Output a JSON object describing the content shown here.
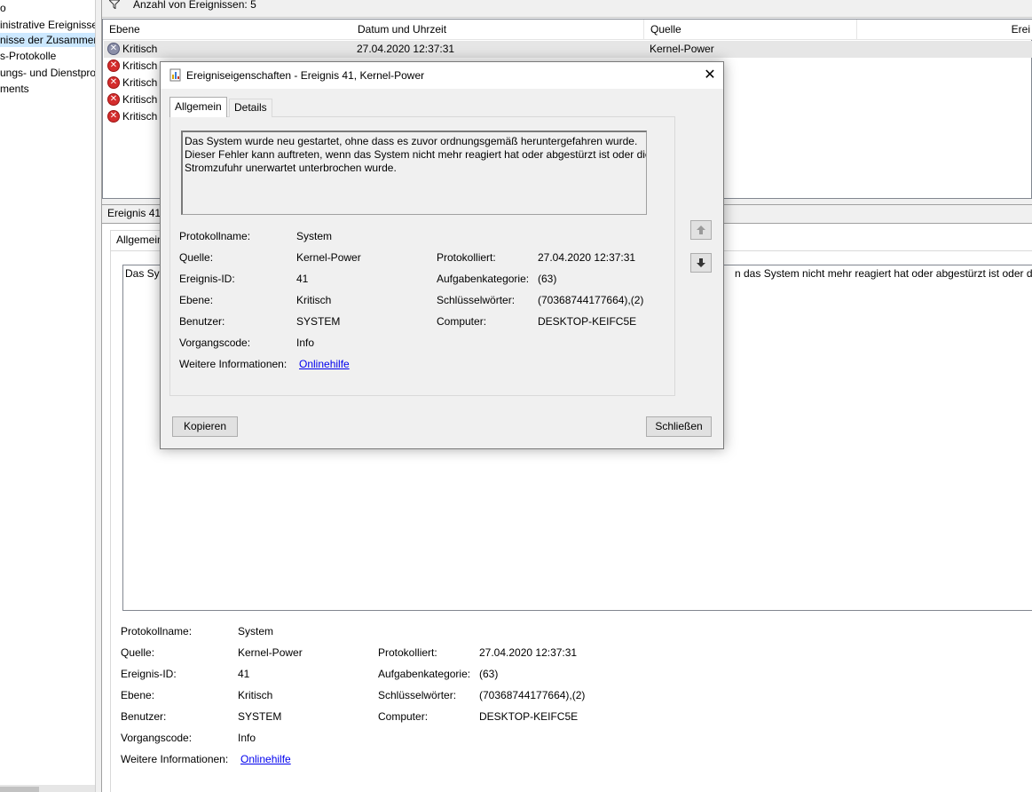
{
  "tree": {
    "items": [
      {
        "label": "o",
        "selected": false
      },
      {
        "label": "inistrative Ereignisse",
        "selected": false
      },
      {
        "label": "nisse der Zusammen",
        "selected": true
      },
      {
        "label": "s-Protokolle",
        "selected": false
      },
      {
        "label": "ungs- und Dienstpro",
        "selected": false
      },
      {
        "label": "ments",
        "selected": false
      }
    ]
  },
  "list": {
    "event_count": "Anzahl von Ereignissen: 5",
    "columns": [
      "Ebene",
      "Datum und Uhrzeit",
      "Quelle",
      "Erei"
    ],
    "rows": [
      {
        "level": "Kritisch",
        "datetime": "27.04.2020 12:37:31",
        "source": "Kernel-Power"
      },
      {
        "level": "Kritisch",
        "datetime": "",
        "source": ""
      },
      {
        "level": "Kritisch",
        "datetime": "",
        "source": ""
      },
      {
        "level": "Kritisch",
        "datetime": "",
        "source": ""
      },
      {
        "level": "Kritisch",
        "datetime": "",
        "source": ""
      }
    ]
  },
  "bottom": {
    "title": "Ereignis 41,",
    "tab": "Allgemein",
    "desc_left": "Das Sys",
    "desc_right": "n das System nicht mehr reagiert hat oder abgestürzt ist oder die S"
  },
  "props": {
    "log_name_label": "Protokollname:",
    "log_name": "System",
    "source_label": "Quelle:",
    "source": "Kernel-Power",
    "event_id_label": "Ereignis-ID:",
    "event_id": "41",
    "level_label": "Ebene:",
    "level": "Kritisch",
    "user_label": "Benutzer:",
    "user": "SYSTEM",
    "opcode_label": "Vorgangscode:",
    "opcode": "Info",
    "more_info_label": "Weitere Informationen:",
    "more_info_link": "Onlinehilfe",
    "logged_label": "Protokolliert:",
    "logged": "27.04.2020 12:37:31",
    "task_label": "Aufgabenkategorie:",
    "task": "(63)",
    "keywords_label": "Schlüsselwörter:",
    "keywords": "(70368744177664),(2)",
    "computer_label": "Computer:",
    "computer": "DESKTOP-KEIFC5E"
  },
  "dialog": {
    "title": "Ereigniseigenschaften - Ereignis 41, Kernel-Power",
    "tabs": [
      "Allgemein",
      "Details"
    ],
    "description_lines": [
      "Das System wurde neu gestartet, ohne dass es zuvor ordnungsgemäß heruntergefahren wurde.",
      "Dieser Fehler kann auftreten, wenn das System nicht mehr reagiert hat oder abgestürzt ist oder die",
      "Stromzufuhr unerwartet unterbrochen wurde."
    ],
    "copy_button": "Kopieren",
    "close_button": "Schließen"
  },
  "icons": {
    "error": "error-circle-icon",
    "filter": "filter-icon",
    "close": "close-icon",
    "up": "arrow-up-icon",
    "down": "arrow-down-icon",
    "event_props": "event-properties-icon"
  },
  "colors": {
    "error_red": "#d42d2d",
    "selection": "#cce8ff",
    "link": "#0000ee"
  }
}
